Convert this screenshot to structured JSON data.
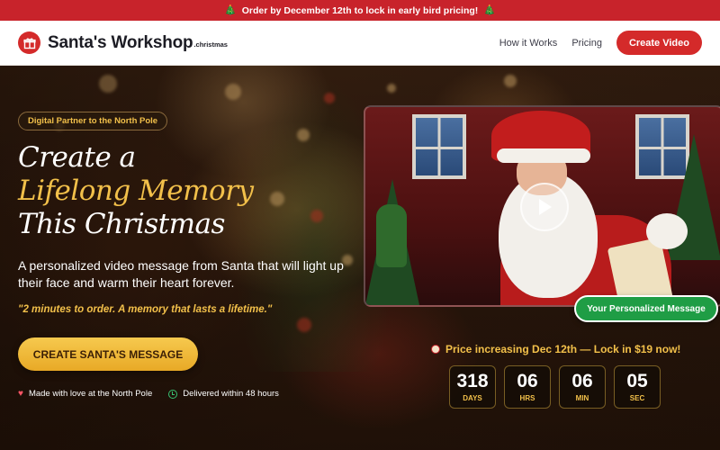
{
  "banner": {
    "left_emoji": "🎄",
    "text": "Order by December 12th to lock in early bird pricing!",
    "right_emoji": "🎄"
  },
  "nav": {
    "logo_icon": "gift-icon",
    "brand": "Santa's Workshop",
    "brand_suffix": ".christmas",
    "links": [
      "How it Works",
      "Pricing"
    ],
    "cta": "Create Video"
  },
  "hero": {
    "partner_badge": "Digital Partner to the North Pole",
    "headline_lines": [
      "Create a",
      "Lifelong Memory",
      "This Christmas"
    ],
    "subtext": "A personalized video message from Santa that will light up their face and warm their heart forever.",
    "quote": "\"2 minutes to order. A memory that lasts a lifetime.\"",
    "cta": "CREATE SANTA'S MESSAGE",
    "trust": [
      {
        "icon": "heart-icon",
        "text": "Made with love at the North Pole"
      },
      {
        "icon": "clock-icon",
        "text": "Delivered within 48 hours"
      }
    ]
  },
  "video": {
    "badge": "Your Personalized Message",
    "play_icon": "play-icon"
  },
  "pricing": {
    "alarm_icon": "alarm-clock-icon",
    "text": "Price increasing Dec 12th — Lock in $19 now!"
  },
  "countdown": [
    {
      "value": "318",
      "label": "DAYS"
    },
    {
      "value": "06",
      "label": "HRS"
    },
    {
      "value": "06",
      "label": "MIN"
    },
    {
      "value": "05",
      "label": "SEC"
    }
  ],
  "colors": {
    "banner_red": "#c8232b",
    "brand_red": "#d42a2a",
    "gold": "#f2c04a",
    "badge_green": "#1f9d45"
  }
}
